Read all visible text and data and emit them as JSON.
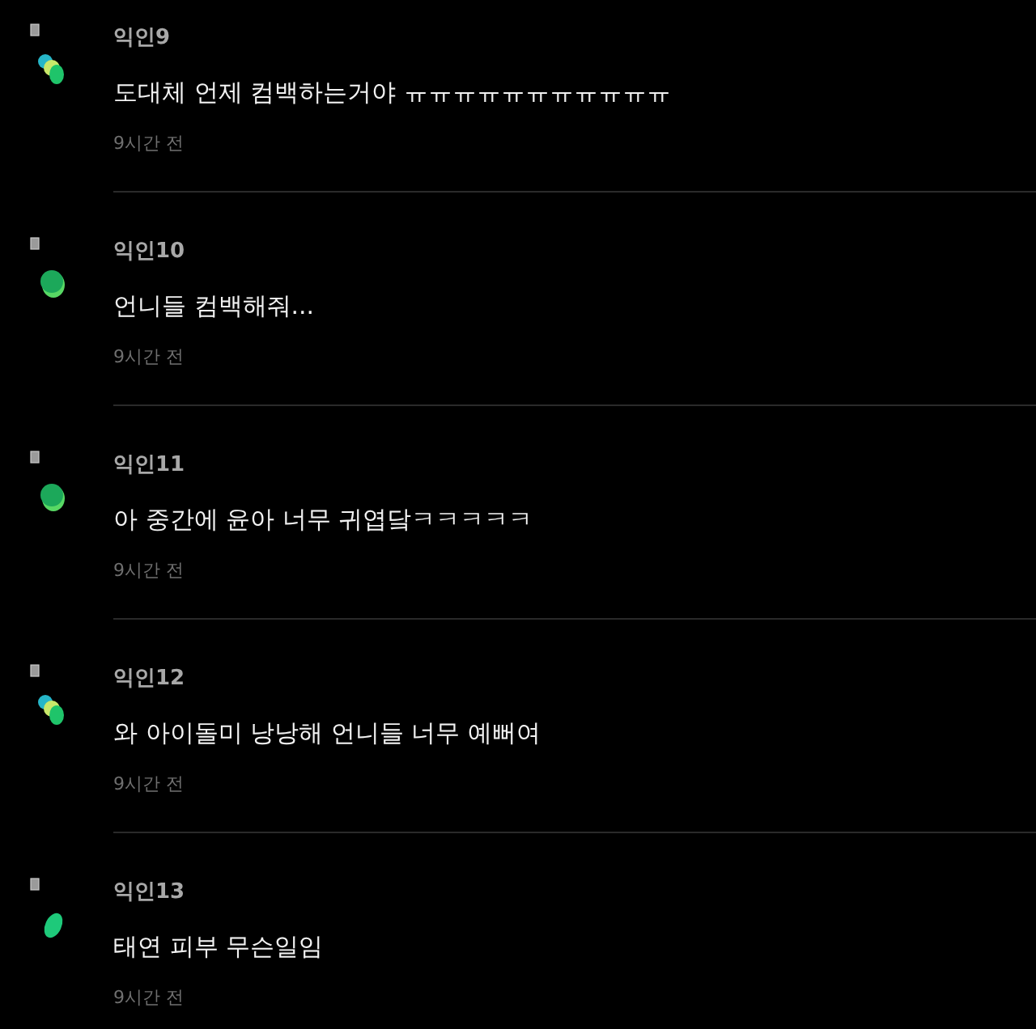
{
  "comments": [
    {
      "author": "익인9",
      "text": "도대체 언제 컴백하는거야 ㅠㅠㅠㅠㅠㅠㅠㅠㅠㅠㅠ",
      "time": "9시간 전",
      "avatar": {
        "kind": "cluster"
      }
    },
    {
      "author": "익인10",
      "text": "언니들 컴백해줘...",
      "time": "9시간 전",
      "avatar": {
        "kind": "disc"
      }
    },
    {
      "author": "익인11",
      "text": "아 중간에 윤아 너무 귀엽닼ㅋㅋㅋㅋㅋ",
      "time": "9시간 전",
      "avatar": {
        "kind": "disc"
      }
    },
    {
      "author": "익인12",
      "text": "와 아이돌미 낭낭해 언니들 너무 예뻐여",
      "time": "9시간 전",
      "avatar": {
        "kind": "cluster"
      }
    },
    {
      "author": "익인13",
      "text": "태연 피부 무슨일임",
      "time": "9시간 전",
      "avatar": {
        "kind": "leaf"
      }
    }
  ]
}
